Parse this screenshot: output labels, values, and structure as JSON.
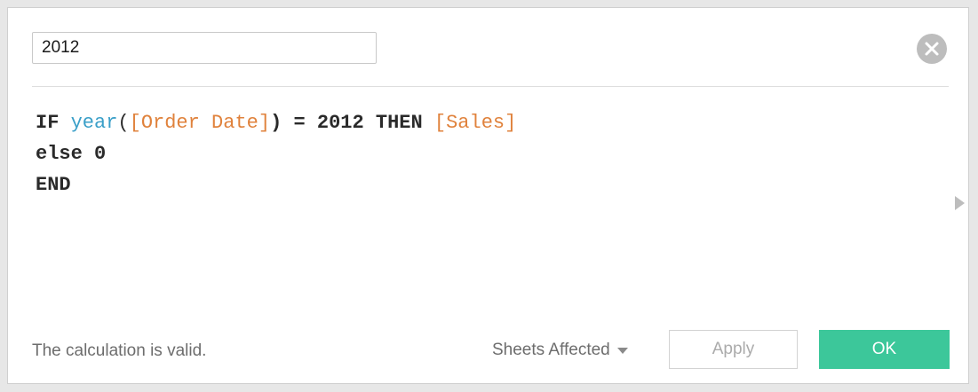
{
  "dialog": {
    "calc_name": "2012",
    "close_icon": "close-circle-icon",
    "formula": {
      "line1": {
        "kw_if": "IF",
        "fn_year": "year",
        "paren_open": "(",
        "field_order_date": "[Order Date]",
        "paren_close_eq": ") = 2012",
        "kw_then": "THEN",
        "field_sales": "[Sales]"
      },
      "line2": {
        "kw_else": "else",
        "value": "0"
      },
      "line3": {
        "kw_end": "END"
      }
    },
    "expand_icon": "triangle-right-icon",
    "status_text": "The calculation is valid.",
    "sheets_affected_label": "Sheets Affected",
    "apply_label": "Apply",
    "ok_label": "OK",
    "colors": {
      "function": "#3a9fc8",
      "field": "#e0823c",
      "ok_button": "#3cc79a"
    }
  }
}
